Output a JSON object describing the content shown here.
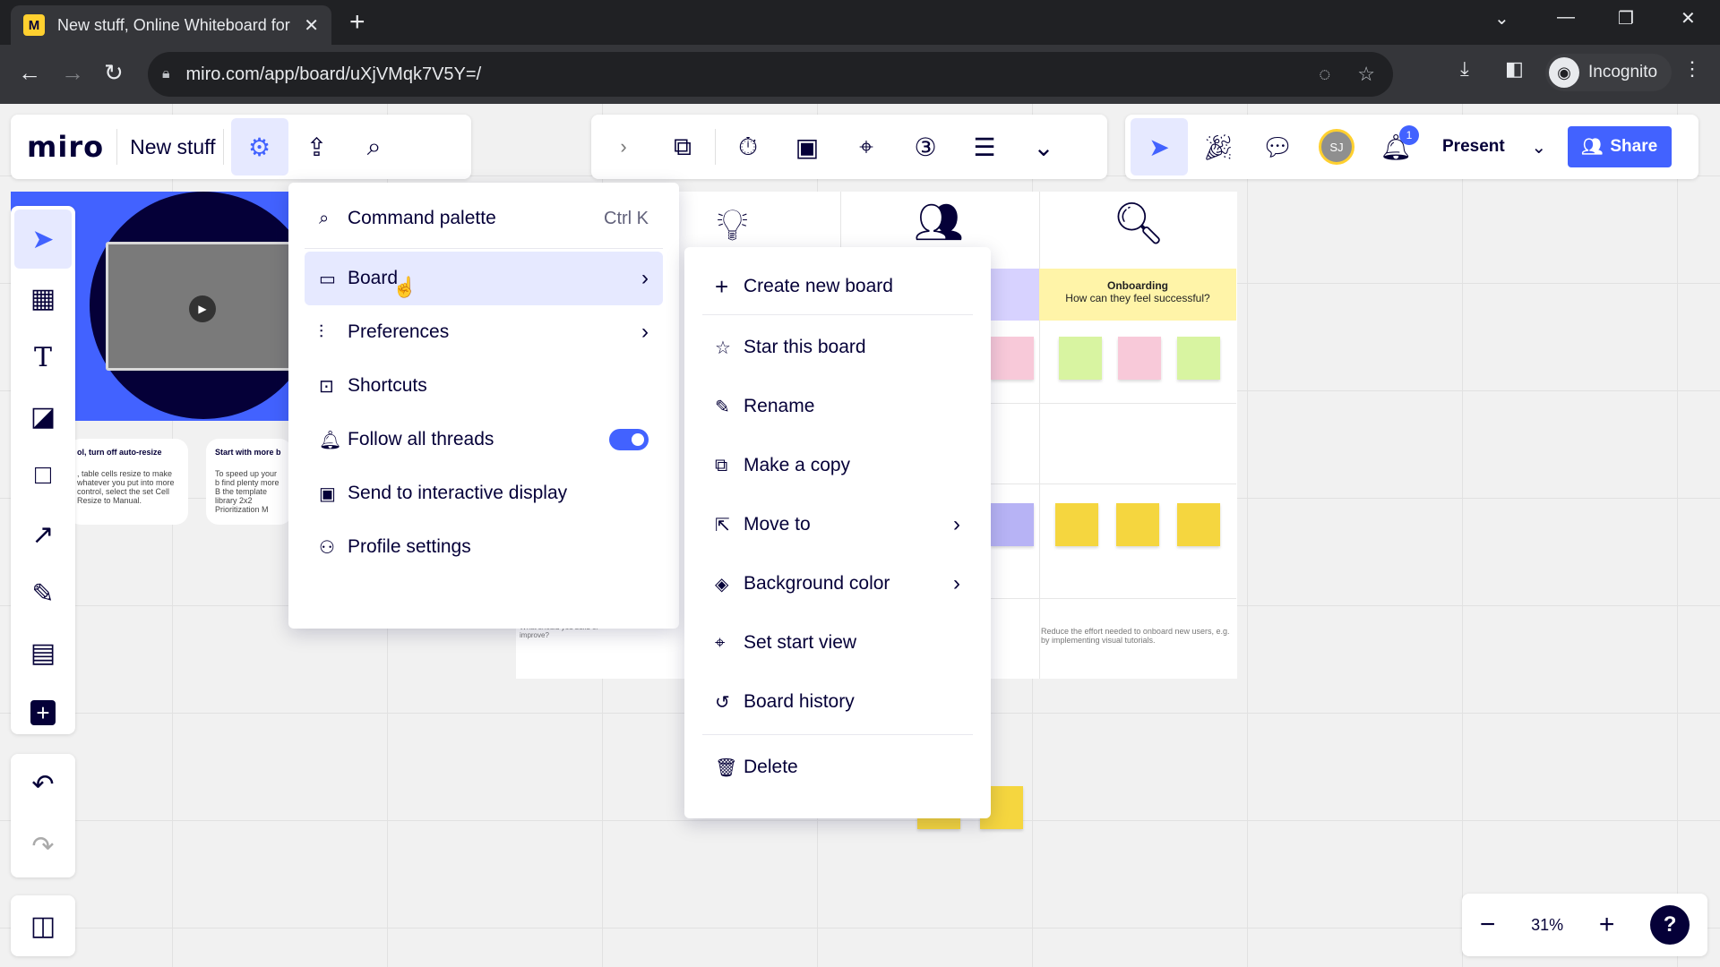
{
  "browser": {
    "tab_title": "New stuff, Online Whiteboard for",
    "favicon": "miro-favicon",
    "url": "miro.com/app/board/uXjVMqk7V5Y=/",
    "profile_label": "Incognito"
  },
  "miro": {
    "logo": "miro",
    "board_name": "New stuff",
    "present_label": "Present",
    "share_label": "Share",
    "avatar_initials": "SJ",
    "notification_count": "1",
    "zoom_level": "31%",
    "help_label": "?"
  },
  "canvas": {
    "onboarding_title": "Onboarding",
    "onboarding_question": "How can they feel successful?",
    "reduce_text": "Reduce the effort needed to onboard new users, e.g. by implementing visual tutorials.",
    "opportunities_text": "What should you build or improve?",
    "tip1_title": "ol, turn off auto-resize",
    "tip1_body": ", table cells resize to make whatever you put into more control, select the set Cell Resize to Manual.",
    "tip2_title": "Start with more b",
    "tip2_body": "To speed up your b find plenty more B the template library 2x2 Prioritization M"
  },
  "main_menu": {
    "items": [
      {
        "icon": "command-palette-icon",
        "glyph": "⌕",
        "label": "Command palette",
        "shortcut": "Ctrl K"
      },
      {
        "icon": "board-icon",
        "glyph": "▭",
        "label": "Board"
      },
      {
        "icon": "preferences-icon",
        "glyph": "⫶",
        "label": "Preferences"
      },
      {
        "icon": "shortcuts-icon",
        "glyph": "⊡",
        "label": "Shortcuts"
      },
      {
        "icon": "bell-icon",
        "glyph": "🔔︎",
        "label": "Follow all threads",
        "toggle_on": true
      },
      {
        "icon": "display-icon",
        "glyph": "▣",
        "label": "Send to interactive display"
      },
      {
        "icon": "user-icon",
        "glyph": "⚇",
        "label": "Profile settings"
      }
    ]
  },
  "board_menu": {
    "items": [
      {
        "glyph": "+",
        "label": "Create new board"
      },
      {
        "glyph": "☆",
        "label": "Star this board"
      },
      {
        "glyph": "✎",
        "label": "Rename"
      },
      {
        "glyph": "⧉",
        "label": "Make a copy"
      },
      {
        "glyph": "⇱",
        "label": "Move to"
      },
      {
        "glyph": "◈",
        "label": "Background color"
      },
      {
        "glyph": "⌖",
        "label": "Set start view"
      },
      {
        "glyph": "↺",
        "label": "Board history"
      },
      {
        "glyph": "🗑︎",
        "label": "Delete"
      }
    ]
  },
  "colors": {
    "accent": "#4262ff",
    "brand_dark": "#050038",
    "brand_yellow": "#ffd02f",
    "highlight": "#e6e9ff"
  }
}
